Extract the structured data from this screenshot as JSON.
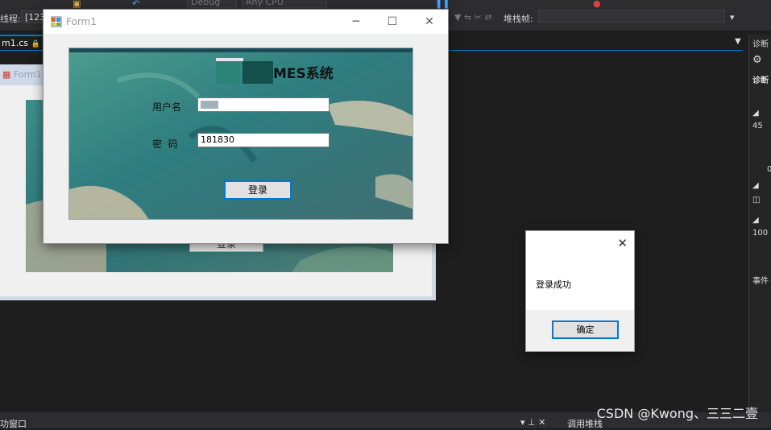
{
  "ide": {
    "toolbar_row2_label": "线程:",
    "thread_combo": "[123",
    "config_combo": "Debug",
    "platform_combo": "Any CPU",
    "stack_frame_label": "堆栈帧:",
    "tab_file": "m1.cs",
    "diag_panel_title": "诊断",
    "diag_tab": "诊断",
    "diag_values": [
      "45",
      "0",
      "100"
    ],
    "diag_events": "事件",
    "bottom_left": "功窗口",
    "bottom_right": "调用堆栈",
    "watermark": "CSDN @Kwong、三三二壹"
  },
  "designer_form": {
    "title": "Form1",
    "button_label": "登录"
  },
  "form1": {
    "title": "Form1",
    "heading": "MES系统",
    "username_label": "用户名",
    "password_label": "密  码",
    "password_value": "181830",
    "login_button": "登录",
    "minimize_icon": "─",
    "maximize_icon": "☐",
    "close_icon": "✕"
  },
  "message_box": {
    "text": "登录成功",
    "ok_button": "确定",
    "close_icon": "✕"
  },
  "colors": {
    "accent": "#0078d7",
    "ide_bg": "#1e1e1e",
    "ide_toolbar": "#2d2d30"
  }
}
